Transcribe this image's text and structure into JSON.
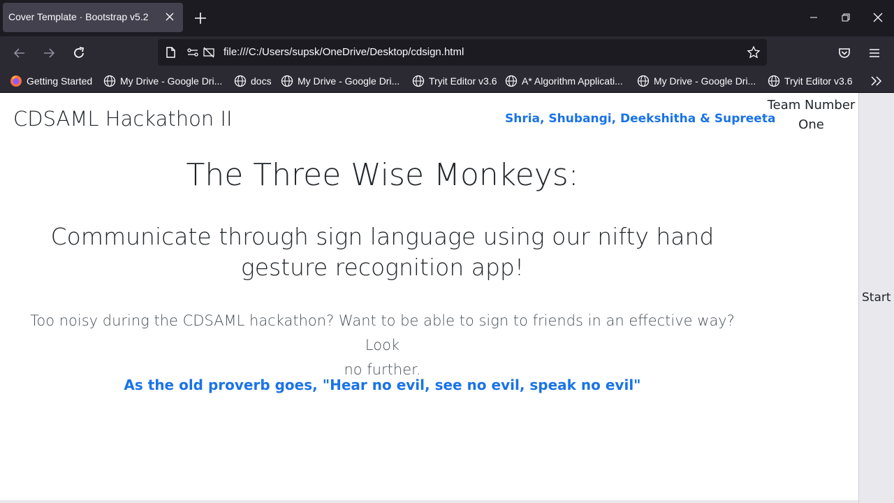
{
  "browser": {
    "tab_title": "Cover Template · Bootstrap v5.2",
    "url": "file:///C:/Users/supsk/OneDrive/Desktop/cdsign.html",
    "bookmarks": [
      {
        "label": "Getting Started",
        "icon": "firefox-icon"
      },
      {
        "label": "My Drive - Google Dri...",
        "icon": "globe-icon"
      },
      {
        "label": "docs",
        "icon": "globe-icon"
      },
      {
        "label": "My Drive - Google Dri...",
        "icon": "globe-icon"
      },
      {
        "label": "Tryit Editor v3.6",
        "icon": "globe-icon"
      },
      {
        "label": "A* Algorithm Applicati...",
        "icon": "globe-icon"
      },
      {
        "label": "My Drive - Google Dri...",
        "icon": "globe-icon"
      },
      {
        "label": "Tryit Editor v3.6",
        "icon": "globe-icon"
      }
    ]
  },
  "page": {
    "brand": "CDSAML Hackathon II",
    "authors": "Shria, Shubangi, Deekshitha & Supreeta",
    "team_line1": "Team Number",
    "team_line2": "One",
    "heading": "The Three Wise Monkeys:",
    "subheading_line1": "Communicate through sign language using our nifty hand",
    "subheading_line2": "gesture recognition app!",
    "lead_line1": "Too noisy during the CDSAML hackathon? Want to be able to sign to friends in an effective way? Look",
    "lead_line2": "no further.",
    "proverb": "As the old proverb goes, \"Hear no evil, see no evil, speak no evil\"",
    "start_label": "Start"
  },
  "colors": {
    "accent": "#1a73e8",
    "text": "#212529",
    "chrome_dark": "#1c1b22",
    "chrome": "#2b2a33"
  }
}
